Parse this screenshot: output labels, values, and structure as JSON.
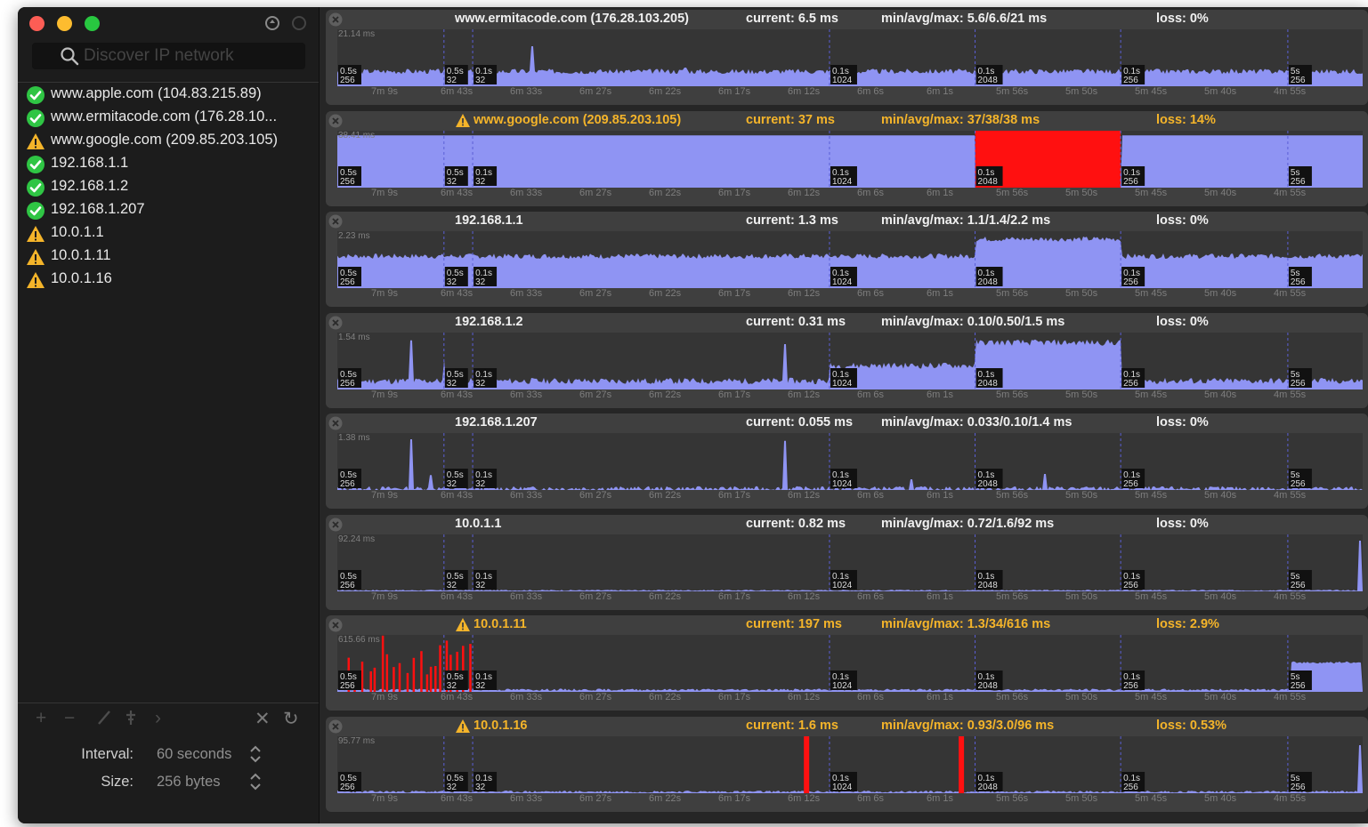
{
  "search": {
    "placeholder": "Discover IP network"
  },
  "hosts": [
    {
      "label": "www.apple.com (104.83.215.89)",
      "status": "ok"
    },
    {
      "label": "www.ermitacode.com (176.28.10...",
      "status": "ok"
    },
    {
      "label": "www.google.com (209.85.203.105)",
      "status": "warning"
    },
    {
      "label": "192.168.1.1",
      "status": "ok"
    },
    {
      "label": "192.168.1.2",
      "status": "ok"
    },
    {
      "label": "192.168.1.207",
      "status": "ok"
    },
    {
      "label": "10.0.1.1",
      "status": "warning"
    },
    {
      "label": "10.0.1.11",
      "status": "warning"
    },
    {
      "label": "10.0.1.16",
      "status": "warning"
    }
  ],
  "settings": {
    "interval_label": "Interval:",
    "interval_value": "60 seconds",
    "size_label": "Size:",
    "size_value": "256 bytes"
  },
  "colors": {
    "ok": "#2fc544",
    "warning": "#f4b42a",
    "fill": "#8f94f3",
    "loss": "#ff1010"
  },
  "time_ticks": [
    "7m 9s",
    "6m 43s",
    "6m 33s",
    "6m 27s",
    "6m 22s",
    "6m 17s",
    "6m 12s",
    "6m 6s",
    "6m 1s",
    "5m 56s",
    "5m 50s",
    "5m 45s",
    "5m 40s",
    "4m 55s"
  ],
  "interval_markers": [
    {
      "t": "0.5s",
      "b": "256"
    },
    {
      "t": "0.5s",
      "b": "32"
    },
    {
      "t": "0.1s",
      "b": "32"
    },
    {
      "t": "0.1s",
      "b": "1024"
    },
    {
      "t": "0.1s",
      "b": "2048"
    },
    {
      "t": "0.1s",
      "b": "256"
    },
    {
      "t": "5s",
      "b": "256"
    }
  ],
  "panels": [
    {
      "host": "www.ermitacode.com (176.28.103.205)",
      "warning": false,
      "current": "current: 6.5 ms",
      "minavgmax": "min/avg/max: 5.6/6.6/21 ms",
      "loss": "loss: 0%",
      "ymax": "21.14 ms",
      "level": 0.28,
      "noise": 0.05,
      "seed": 3,
      "spikes": [
        [
          0.19,
          0.75
        ],
        [
          0.34,
          0.35
        ]
      ],
      "segs": [],
      "loss_pos": []
    },
    {
      "host": "www.google.com (209.85.203.105)",
      "warning": true,
      "current": "current: 37 ms",
      "minavgmax": "min/avg/max: 37/38/38 ms",
      "loss": "loss: 14%",
      "ymax": "38.41 ms",
      "level": 0.98,
      "noise": 0.0,
      "seed": 5,
      "spikes": [],
      "segs": [],
      "loss_block": [
        0.622,
        0.764
      ],
      "loss_pos": []
    },
    {
      "host": "192.168.1.1",
      "warning": false,
      "current": "current: 1.3 ms",
      "minavgmax": "min/avg/max: 1.1/1.4/2.2 ms",
      "loss": "loss: 0%",
      "ymax": "2.23 ms",
      "level": 0.6,
      "noise": 0.05,
      "seed": 7,
      "spikes": [],
      "segs": [
        [
          0.622,
          0.764,
          0.92
        ]
      ],
      "loss_pos": []
    },
    {
      "host": "192.168.1.2",
      "warning": false,
      "current": "current: 0.31 ms",
      "minavgmax": "min/avg/max: 0.10/0.50/1.5 ms",
      "loss": "loss: 0%",
      "ymax": "1.54 ms",
      "level": 0.16,
      "noise": 0.06,
      "seed": 11,
      "spikes": [
        [
          0.072,
          0.92
        ],
        [
          0.104,
          0.55
        ],
        [
          0.437,
          0.85
        ]
      ],
      "segs": [
        [
          0.48,
          0.622,
          0.45
        ],
        [
          0.622,
          0.764,
          0.88
        ]
      ],
      "loss_pos": []
    },
    {
      "host": "192.168.1.207",
      "warning": false,
      "current": "current: 0.055 ms",
      "minavgmax": "min/avg/max: 0.033/0.10/1.4 ms",
      "loss": "loss: 0%",
      "ymax": "1.38 ms",
      "level": 0.03,
      "noise": 0.04,
      "seed": 13,
      "spikes": [
        [
          0.072,
          0.95
        ],
        [
          0.091,
          0.28
        ],
        [
          0.437,
          0.92
        ],
        [
          0.56,
          0.2
        ],
        [
          0.69,
          0.3
        ]
      ],
      "segs": [],
      "loss_pos": []
    },
    {
      "host": "10.0.1.1",
      "warning": false,
      "current": "current: 0.82 ms",
      "minavgmax": "min/avg/max: 0.72/1.6/92 ms",
      "loss": "loss: 0%",
      "ymax": "92.24 ms",
      "level": 0.02,
      "noise": 0.01,
      "seed": 17,
      "spikes": [
        [
          0.997,
          0.95
        ]
      ],
      "segs": [],
      "loss_pos": []
    },
    {
      "host": "10.0.1.11",
      "warning": true,
      "current": "current: 197 ms",
      "minavgmax": "min/avg/max: 1.3/34/616 ms",
      "loss": "loss: 2.9%",
      "ymax": "615.66 ms",
      "level": 0.04,
      "noise": 0.02,
      "seed": 19,
      "spikes": [],
      "segs": [
        [
          0.93,
          1.0,
          0.55
        ]
      ],
      "loss_range": [
        0.01,
        0.135
      ],
      "loss_pos": []
    },
    {
      "host": "10.0.1.16",
      "warning": true,
      "current": "current: 1.6 ms",
      "minavgmax": "min/avg/max: 0.93/3.0/96 ms",
      "loss": "loss: 0.53%",
      "ymax": "95.77 ms",
      "level": 0.03,
      "noise": 0.02,
      "seed": 23,
      "spikes": [
        [
          0.997,
          0.9
        ]
      ],
      "segs": [],
      "loss_pos": [
        0.455,
        0.606
      ]
    }
  ]
}
